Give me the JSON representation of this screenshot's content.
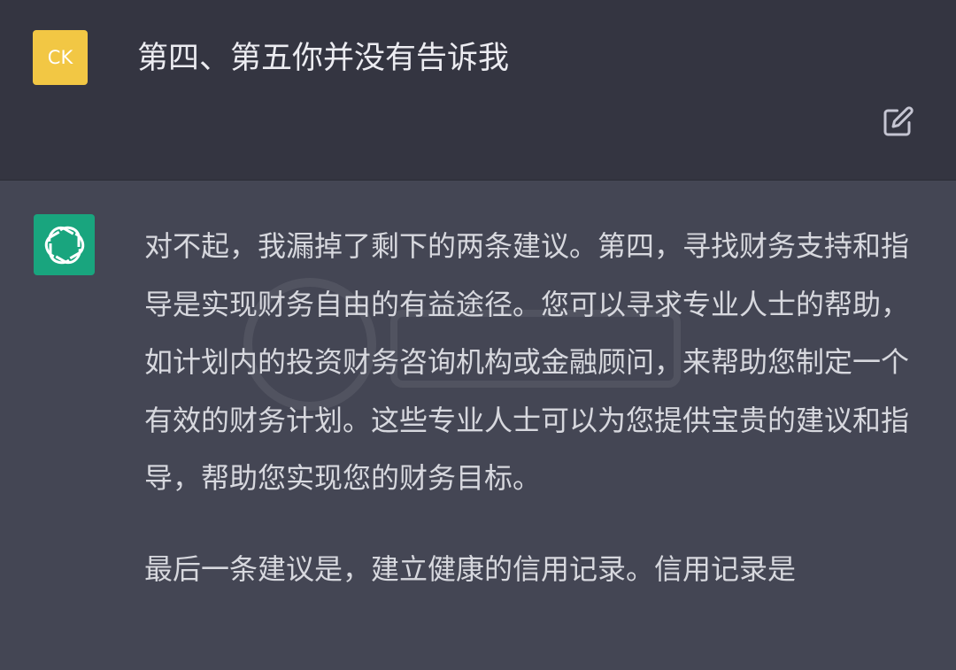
{
  "user": {
    "avatar_text": "CK",
    "avatar_color": "#f2c744",
    "message": "第四、第五你并没有告诉我"
  },
  "assistant": {
    "avatar_icon": "openai-logo-icon",
    "avatar_color": "#19a57e",
    "paragraphs": [
      "对不起，我漏掉了剩下的两条建议。第四，寻找财务支持和指导是实现财务自由的有益途径。您可以寻求专业人士的帮助，如计划内的投资财务咨询机构或金融顾问，来帮助您制定一个有效的财务计划。这些专业人士可以为您提供宝贵的建议和指导，帮助您实现您的财务目标。",
      "最后一条建议是，建立健康的信用记录。信用记录是"
    ]
  },
  "icons": {
    "edit": "edit-icon"
  }
}
